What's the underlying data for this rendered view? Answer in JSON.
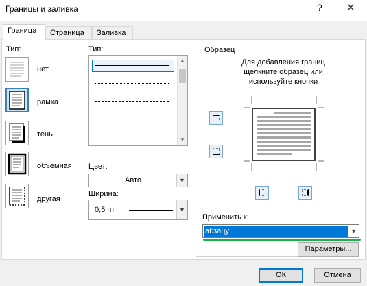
{
  "window": {
    "title": "Границы и заливка",
    "help_glyph": "?",
    "close_glyph": "✕"
  },
  "tabs": [
    {
      "label": "Граница",
      "active": true
    },
    {
      "label": "Страница",
      "active": false
    },
    {
      "label": "Заливка",
      "active": false
    }
  ],
  "settings": {
    "header": "Тип:",
    "items": [
      {
        "label": "нет",
        "icon": "border-none-icon"
      },
      {
        "label": "рамка",
        "icon": "border-box-icon",
        "selected": true
      },
      {
        "label": "тень",
        "icon": "border-shadow-icon"
      },
      {
        "label": "объемная",
        "icon": "border-3d-icon"
      },
      {
        "label": "другая",
        "icon": "border-custom-icon"
      }
    ]
  },
  "style": {
    "header": "Тип:",
    "line_styles": [
      "solid",
      "dotted",
      "dashed-small",
      "dashed",
      "dash-dot"
    ]
  },
  "color": {
    "label": "Цвет:",
    "value": "Авто"
  },
  "width": {
    "label": "Ширина:",
    "value": "0,5 пт"
  },
  "preview": {
    "header": "Образец",
    "hint": "Для добавления границ щелкните образец или используйте кнопки"
  },
  "apply": {
    "label": "Применить к:",
    "value": "абзацу"
  },
  "buttons": {
    "options": "Параметры...",
    "ok": "ОК",
    "cancel": "Отмена"
  },
  "colors": {
    "accent": "#0078d7",
    "highlight_underline": "#18b14b",
    "selected_tile": "#cde6f7"
  }
}
